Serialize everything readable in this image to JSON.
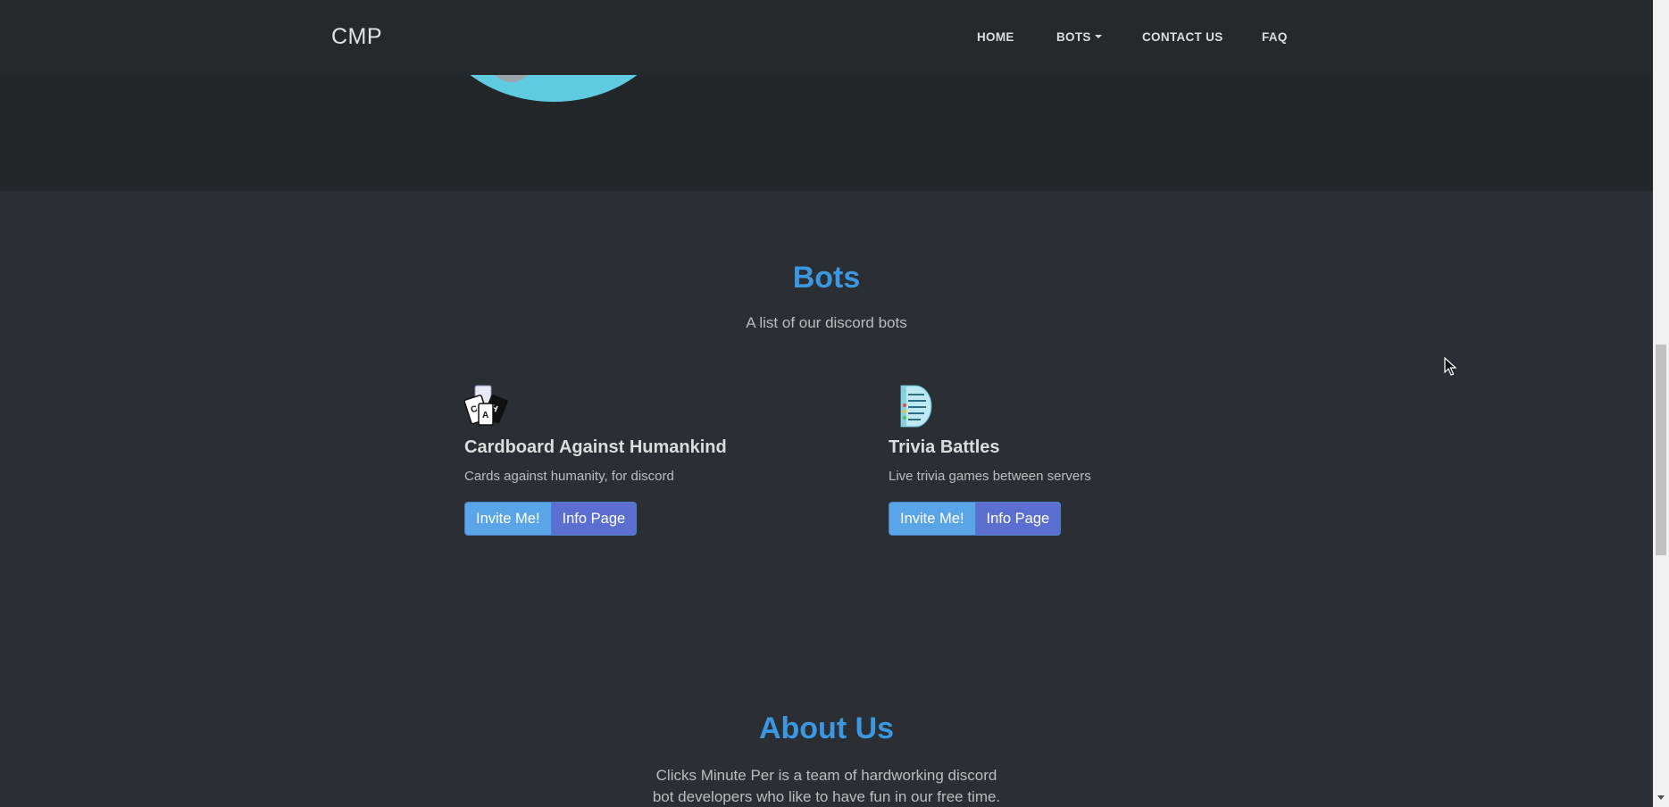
{
  "navbar": {
    "brand": "CMP",
    "items": [
      {
        "label": "HOME"
      },
      {
        "label": "BOTS"
      },
      {
        "label": "CONTACT US"
      },
      {
        "label": "FAQ"
      }
    ]
  },
  "bots": {
    "title": "Bots",
    "subtitle": "A list of our discord bots",
    "cards": [
      {
        "icon": "cards-icon",
        "name": "Cardboard Against Humankind",
        "description": "Cards against humanity, for discord",
        "invite_label": "Invite Me!",
        "info_label": "Info Page"
      },
      {
        "icon": "trivia-document-icon",
        "name": "Trivia Battles",
        "description": "Live trivia games between servers",
        "invite_label": "Invite Me!",
        "info_label": "Info Page"
      }
    ]
  },
  "about": {
    "title": "About Us",
    "text_line1": "Clicks Minute Per is a team of hardworking discord",
    "text_line2": "bot developers who like to have fun in our free time."
  },
  "colors": {
    "accent": "#3a97e0",
    "invite_button": "#5aa4e8",
    "info_button": "#5c6fd1",
    "background": "#2b2f33",
    "navbar": "#25292c"
  }
}
